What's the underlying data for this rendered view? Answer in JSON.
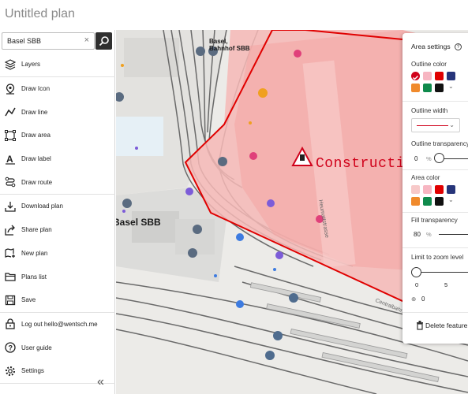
{
  "app": {
    "title": "Untitled plan"
  },
  "search": {
    "value": "Basel SBB",
    "clear_symbol": "×"
  },
  "menu": [
    {
      "id": "layers",
      "label": "Layers",
      "icon": "layers-icon"
    },
    {
      "id": "draw-icon",
      "label": "Draw Icon",
      "icon": "location-pin-icon"
    },
    {
      "id": "draw-line",
      "label": "Draw line",
      "icon": "polyline-icon"
    },
    {
      "id": "draw-area",
      "label": "Draw area",
      "icon": "polygon-icon"
    },
    {
      "id": "draw-label",
      "label": "Draw label",
      "icon": "text-icon"
    },
    {
      "id": "draw-route",
      "label": "Draw route",
      "icon": "route-icon"
    },
    {
      "id": "download-plan",
      "label": "Download plan",
      "icon": "download-icon"
    },
    {
      "id": "share-plan",
      "label": "Share plan",
      "icon": "share-icon"
    },
    {
      "id": "new-plan",
      "label": "New plan",
      "icon": "new-map-icon"
    },
    {
      "id": "plans-list",
      "label": "Plans list",
      "icon": "folder-icon"
    },
    {
      "id": "save",
      "label": "Save",
      "icon": "save-icon"
    },
    {
      "id": "logout",
      "label": "Log out hello@wentsch.me",
      "icon": "lock-icon"
    },
    {
      "id": "user-guide",
      "label": "User guide",
      "icon": "help-icon"
    },
    {
      "id": "settings",
      "label": "Settings",
      "icon": "gear-icon"
    }
  ],
  "collapse_symbol": "«",
  "map": {
    "labels": {
      "station_top": "Basel,\nBahnhof SBB",
      "station_main": "Basel SBB",
      "street_vertical": "Heumattstrasse",
      "street_bottom": "Centralbahn"
    },
    "annotation_text": "Construction",
    "area_color": "#f5a8a8",
    "outline_color": "#e00000"
  },
  "panel": {
    "title": "Area settings",
    "outline_color_label": "Outline color",
    "outline_colors": [
      "#d0021b",
      "#f7b6c2",
      "#e00000",
      "#27357a",
      "#f08a2c",
      "#0f8a4c",
      "#111111"
    ],
    "outline_selected": "#d0021b",
    "outline_width_label": "Outline width",
    "outline_transparency_label": "Outline transparency",
    "outline_transparency_value": "0",
    "area_color_label": "Area color",
    "area_colors": [
      "#f7c9c9",
      "#f7b6c2",
      "#e00000",
      "#27357a",
      "#f08a2c",
      "#0f8a4c",
      "#111111"
    ],
    "fill_transparency_label": "Fill transparency",
    "fill_transparency_value": "80",
    "percent": "%",
    "zoom_label": "Limit to zoom level",
    "zoom_min": "0",
    "zoom_tick": "5",
    "zoom_value": "0",
    "delete_label": "Delete feature"
  }
}
